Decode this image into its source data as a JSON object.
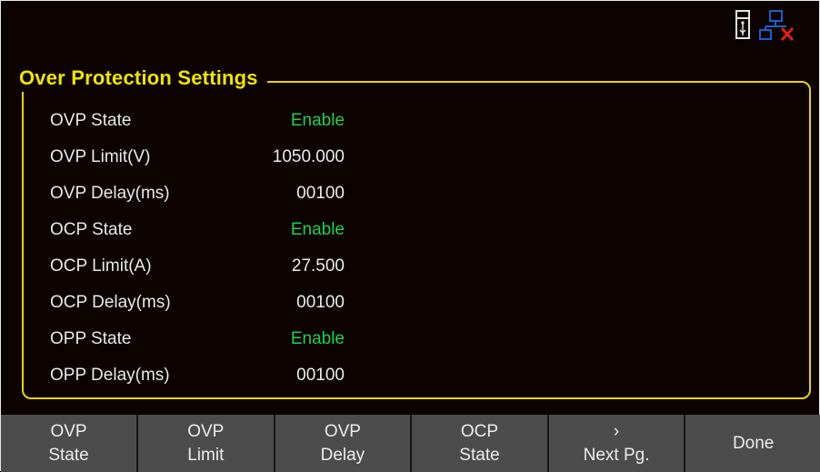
{
  "status_icons": [
    "usb-icon",
    "lan-disconnected-icon"
  ],
  "group": {
    "title": "Over Protection Settings",
    "rows": [
      {
        "label": "OVP State",
        "value": "Enable"
      },
      {
        "label": "OVP Limit(V)",
        "value": "1050.000"
      },
      {
        "label": "OVP Delay(ms)",
        "value": "00100"
      },
      {
        "label": "OCP State",
        "value": "Enable"
      },
      {
        "label": "OCP Limit(A)",
        "value": "27.500"
      },
      {
        "label": "OCP Delay(ms)",
        "value": "00100"
      },
      {
        "label": "OPP State",
        "value": "Enable"
      },
      {
        "label": "OPP Delay(ms)",
        "value": "00100"
      }
    ]
  },
  "softkeys": [
    {
      "line1": "OVP",
      "line2": "State"
    },
    {
      "line1": "OVP",
      "line2": "Limit"
    },
    {
      "line1": "OVP",
      "line2": "Delay"
    },
    {
      "line1": "OCP",
      "line2": "State"
    },
    {
      "line1": "›",
      "line2": "Next Pg."
    },
    {
      "line1": "Done",
      "line2": ""
    }
  ],
  "colors": {
    "background": "#0c0200",
    "accent_yellow": "#efe500",
    "enable_green": "#22d14a",
    "softkey_bg": "#4c4c4c",
    "lan_blue": "#1a5fd0",
    "lan_red": "#e02010"
  }
}
